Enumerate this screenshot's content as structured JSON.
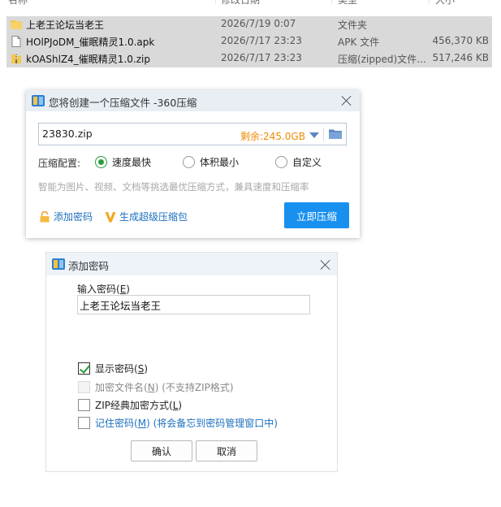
{
  "explorer": {
    "columns": [
      "名称",
      "修改日期",
      "类型",
      "大小"
    ],
    "files": [
      {
        "name": "上老王论坛当老王",
        "date": "2026/7/19 0:07",
        "type": "文件夹",
        "size": "",
        "icon": "folder-icon"
      },
      {
        "name": "HOlPJoDM_催眠精灵1.0.apk",
        "date": "2026/7/17 23:23",
        "type": "APK 文件",
        "size": "456,370 KB",
        "icon": "apk-file-icon"
      },
      {
        "name": "kOAShlZ4_催眠精灵1.0.zip",
        "date": "2026/7/17 23:23",
        "type": "压缩(zipped)文件...",
        "size": "517,246 KB",
        "icon": "zip-file-icon"
      }
    ]
  },
  "compress_dialog": {
    "title": "您将创建一个压缩文件 -360压缩",
    "filename": "23830.zip",
    "free_space": "剩余:245.0GB",
    "config_label": "压缩配置:",
    "options": [
      "速度最快",
      "体积最小",
      "自定义"
    ],
    "selected_option": "速度最快",
    "hint": "智能为图片、视频、文档等挑选最优压缩方式，兼具速度和压缩率",
    "add_password": "添加密码",
    "super_package": "生成超级压缩包",
    "compress_now": "立即压缩",
    "accent_color": "#1890f0"
  },
  "password_dialog": {
    "title": "添加密码",
    "input_label": "输入密码",
    "input_hotkey": "E",
    "password_value": "上老王论坛当老王",
    "show_password": {
      "label": "显示密码",
      "hotkey": "S",
      "checked": true
    },
    "encrypt_names": {
      "label": "加密文件名",
      "hotkey": "N",
      "note": "(不支持ZIP格式)",
      "checked": false,
      "disabled": true
    },
    "zip_classic": {
      "label": "ZIP经典加密方式",
      "hotkey": "L",
      "checked": false
    },
    "remember": {
      "label": "记住密码",
      "hotkey": "M",
      "note": "(将会备忘到密码管理窗口中)",
      "checked": false
    },
    "ok": "确认",
    "cancel": "取消"
  }
}
